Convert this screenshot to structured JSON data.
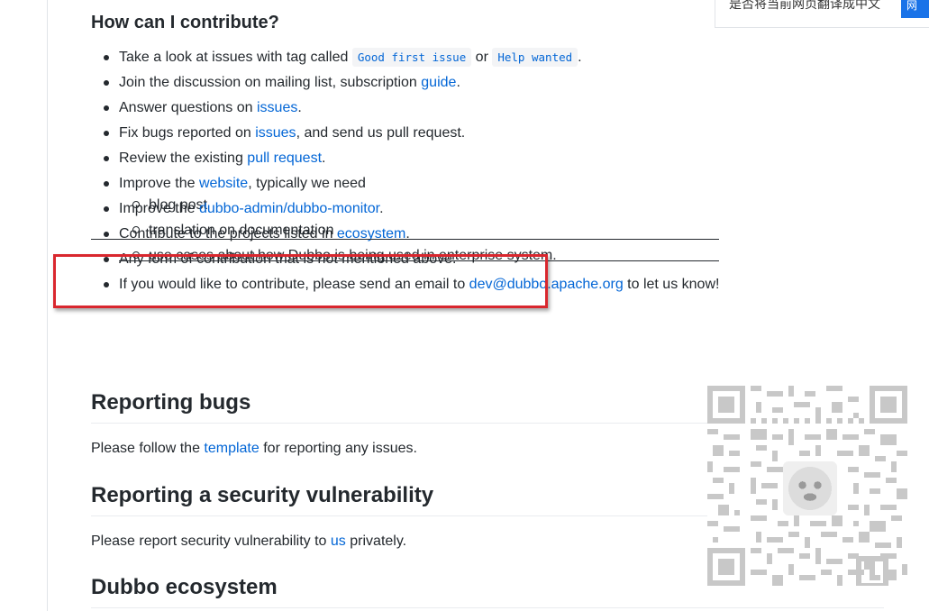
{
  "translate": {
    "text": "是否将当前网页翻译成中文",
    "button": "网"
  },
  "contribute": {
    "heading": "How can I contribute?",
    "items": [
      {
        "t1": "Take a look at issues with tag called ",
        "code1": "Good first issue",
        "t2": " or ",
        "code2": "Help wanted",
        "t3": "."
      },
      {
        "t1": "Join the discussion on mailing list, subscription ",
        "link": "guide",
        "t2": "."
      },
      {
        "t1": "Answer questions on ",
        "link": "issues",
        "t2": "."
      },
      {
        "t1": "Fix bugs reported on ",
        "link": "issues",
        "t2": ", and send us pull request."
      },
      {
        "t1": "Review the existing ",
        "link": "pull request",
        "t2": "."
      },
      {
        "t1": "Improve the ",
        "link": "website",
        "t2": ", typically we need",
        "sub": [
          "blog post",
          "translation on documentation",
          "use cases about how Dubbo is being used in enterprise system."
        ]
      },
      {
        "t1": "Improve the ",
        "link": "dubbo-admin/dubbo-monitor",
        "t2": "."
      },
      {
        "t1": "Contribute to the projects listed in ",
        "link": "ecosystem",
        "t2": "."
      },
      {
        "t1": "Any form of contribution that is not mentioned above."
      },
      {
        "t1": "If you would like to contribute, please send an email to ",
        "link": "dev@dubbo.apache.org",
        "t2": " to let us know!"
      }
    ]
  },
  "bugs": {
    "heading": "Reporting bugs",
    "t1": "Please follow the ",
    "link": "template",
    "t2": " for reporting any issues."
  },
  "security": {
    "heading": "Reporting a security vulnerability",
    "t1": "Please report security vulnerability to ",
    "link": "us",
    "t2": " privately."
  },
  "ecosystem": {
    "heading": "Dubbo ecosystem"
  },
  "icons": {
    "qr": "qr-code-icon"
  }
}
